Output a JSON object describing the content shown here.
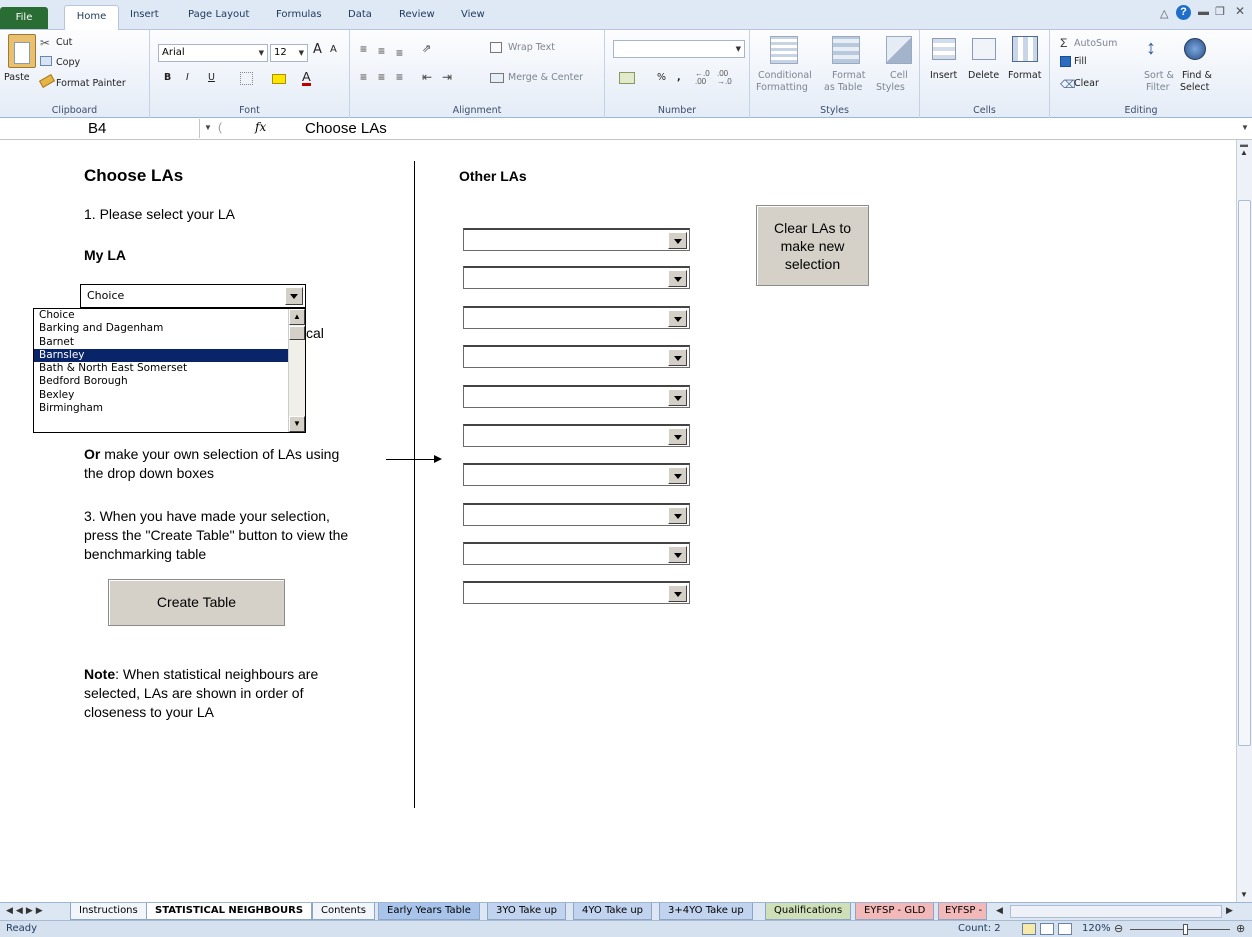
{
  "ribbon_tabs": [
    "File",
    "Home",
    "Insert",
    "Page Layout",
    "Formulas",
    "Data",
    "Review",
    "View"
  ],
  "clipboard": {
    "paste": "Paste",
    "cut": "Cut",
    "copy": "Copy",
    "format_painter": "Format Painter",
    "label": "Clipboard"
  },
  "font": {
    "name": "Arial",
    "size": "12",
    "label": "Font",
    "bold": "B",
    "italic": "I",
    "underline": "U",
    "grow": "A",
    "shrink": "A"
  },
  "alignment": {
    "wrap": "Wrap Text",
    "merge": "Merge & Center",
    "label": "Alignment"
  },
  "number": {
    "format": "",
    "percent": "%",
    "comma": ",",
    "label": "Number"
  },
  "styles": {
    "conditional": "Conditional",
    "conditional2": "Formatting",
    "format_table": "Format",
    "format_table2": "as Table",
    "cell_styles": "Cell",
    "cell_styles2": "Styles",
    "label": "Styles"
  },
  "cells": {
    "insert": "Insert",
    "delete": "Delete",
    "format": "Format",
    "label": "Cells"
  },
  "editing": {
    "autosum": "AutoSum",
    "fill": "Fill",
    "clear": "Clear",
    "sort": "Sort &",
    "sort2": "Filter",
    "find": "Find &",
    "find2": "Select",
    "label": "Editing"
  },
  "formula_bar": {
    "cell_ref": "B4",
    "fx": "fx",
    "content": "Choose LAs"
  },
  "sheet": {
    "title": "Choose LAs",
    "step1": "1. Please select your LA",
    "my_la": "My LA",
    "combo_value": "Choice",
    "hidden_fragment": "cal",
    "or_bold": "Or",
    "or_text": " make your own selection of LAs using",
    "or_text2": "the drop down boxes",
    "step3_l1": "3. When you have made your selection,",
    "step3_l2": "press the \"Create Table\" button to view the",
    "step3_l3": "benchmarking table",
    "create_button": "Create Table",
    "note_bold": "Note",
    "note_l1": ": When statistical neighbours are",
    "note_l2": "selected, LAs are shown in order of",
    "note_l3": "closeness to your LA",
    "other_las": "Other LAs",
    "clear_l1": "Clear LAs to",
    "clear_l2": "make new",
    "clear_l3": "selection"
  },
  "dropdown_list": [
    "Choice",
    "Barking and Dagenham",
    "Barnet",
    "Barnsley",
    "Bath & North East Somerset",
    "Bedford Borough",
    "Bexley",
    "Birmingham"
  ],
  "dropdown_selected": "Barnsley",
  "sheet_tabs": [
    "Instructions",
    "STATISTICAL NEIGHBOURS",
    "Contents",
    "Early Years Table",
    "3YO Take up",
    "4YO Take up",
    "3+4YO Take up",
    "Qualifications",
    "EYFSP - GLD",
    "EYFSP - "
  ],
  "active_sheet_tab": "STATISTICAL NEIGHBOURS",
  "status": {
    "ready": "Ready",
    "count": "Count: 2",
    "zoom": "120%"
  }
}
